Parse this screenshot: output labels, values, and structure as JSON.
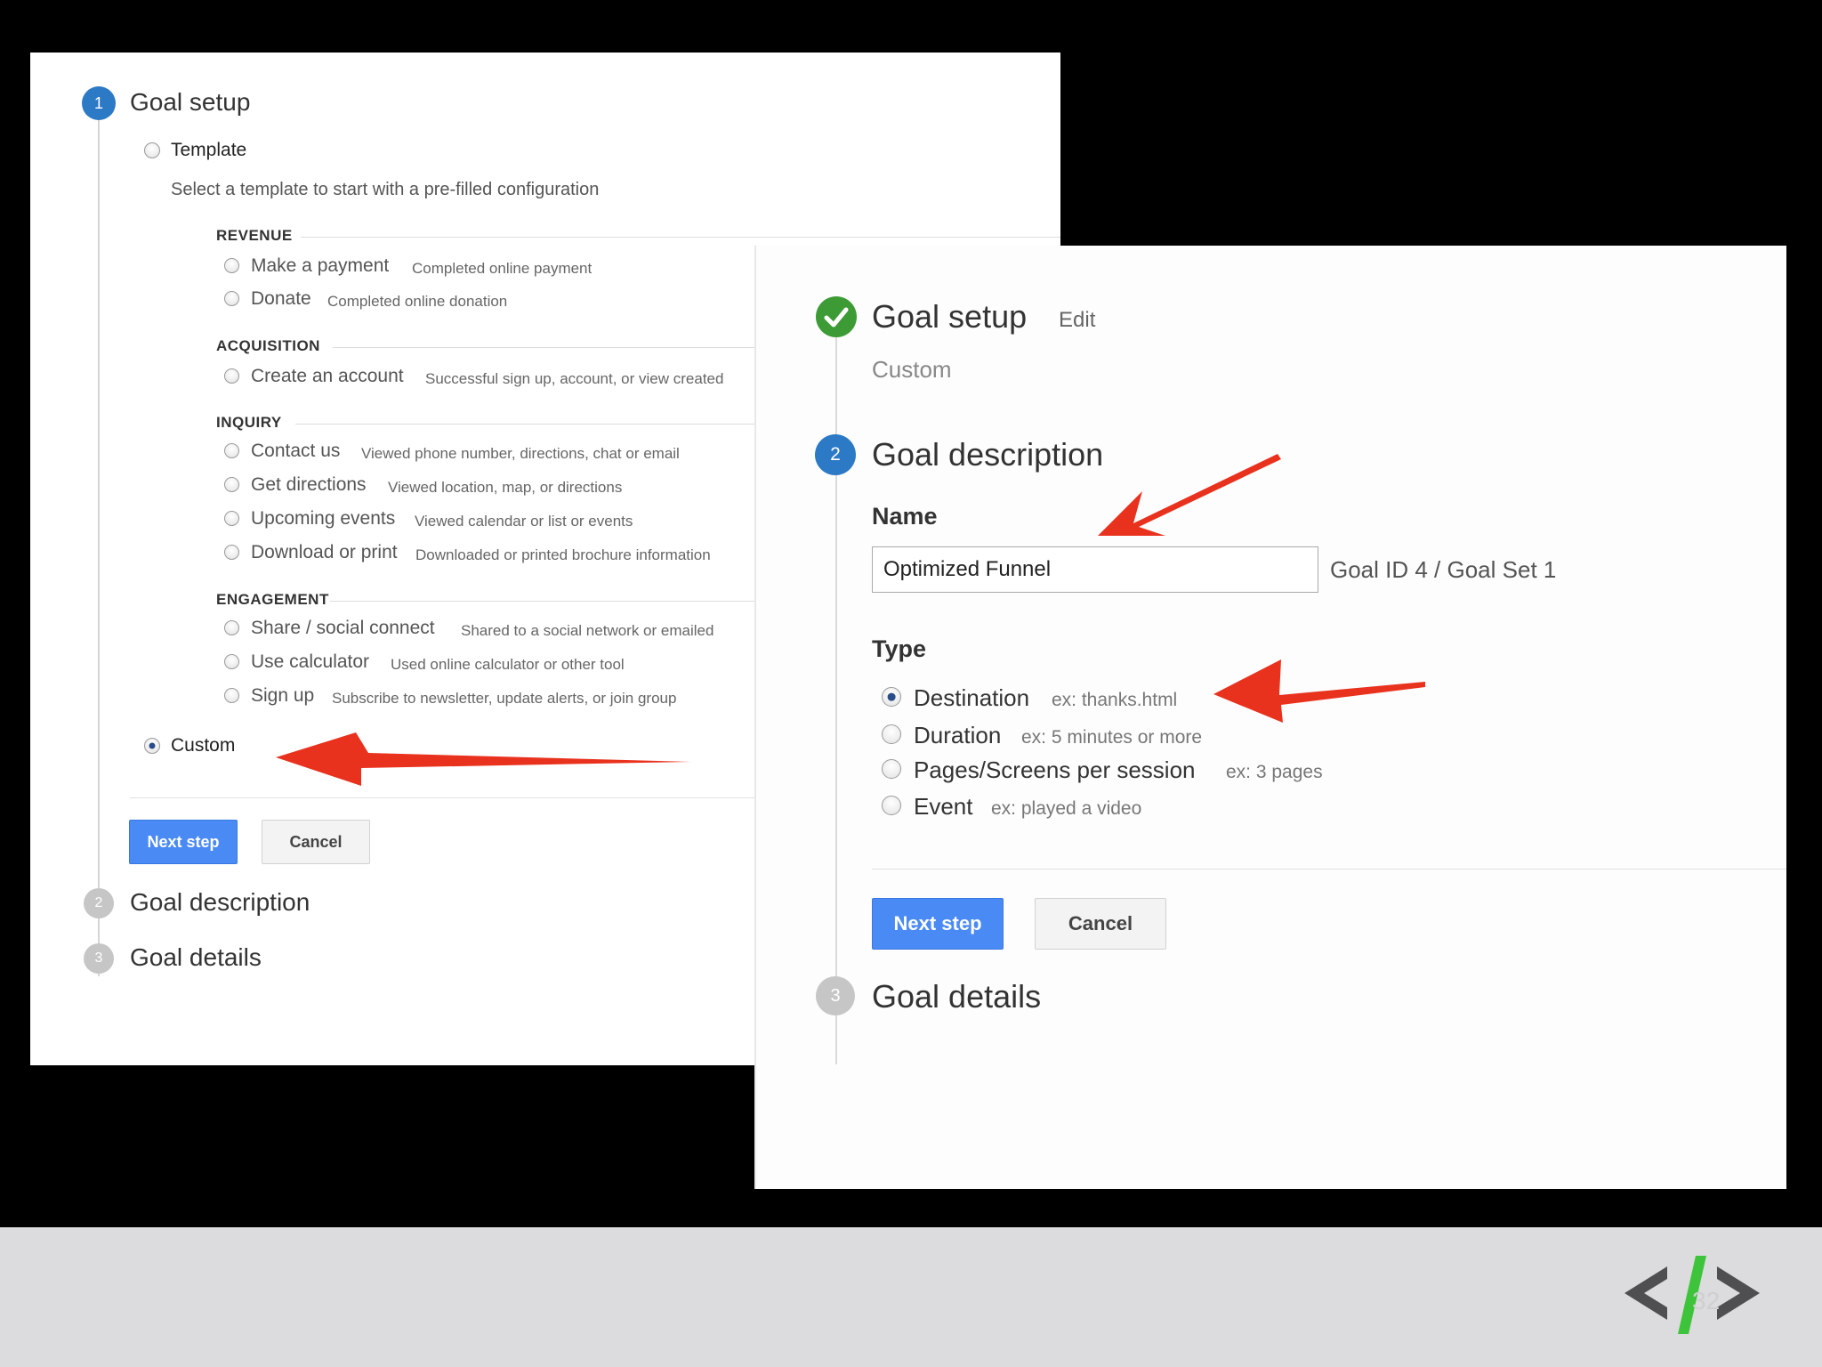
{
  "left_panel": {
    "step1": {
      "number": "1",
      "title": "Goal setup"
    },
    "template_label": "Template",
    "template_help": "Select a template to start with a pre-filled configuration",
    "categories": [
      {
        "label": "REVENUE",
        "items": [
          {
            "name": "Make a payment",
            "desc": "Completed online payment"
          },
          {
            "name": "Donate",
            "desc": "Completed online donation"
          }
        ]
      },
      {
        "label": "ACQUISITION",
        "items": [
          {
            "name": "Create an account",
            "desc": "Successful sign up, account, or view created"
          }
        ]
      },
      {
        "label": "INQUIRY",
        "items": [
          {
            "name": "Contact us",
            "desc": "Viewed phone number, directions, chat or email"
          },
          {
            "name": "Get directions",
            "desc": "Viewed location, map, or directions"
          },
          {
            "name": "Upcoming events",
            "desc": "Viewed calendar or list or events"
          },
          {
            "name": "Download or print",
            "desc": "Downloaded or printed brochure information"
          }
        ]
      },
      {
        "label": "ENGAGEMENT",
        "items": [
          {
            "name": "Share / social connect",
            "desc": "Shared to a social network or emailed"
          },
          {
            "name": "Use calculator",
            "desc": "Used online calculator or other tool"
          },
          {
            "name": "Sign up",
            "desc": "Subscribe to newsletter, update alerts, or join group"
          }
        ]
      }
    ],
    "custom_label": "Custom",
    "next_label": "Next step",
    "cancel_label": "Cancel",
    "step2": {
      "number": "2",
      "title": "Goal description"
    },
    "step3": {
      "number": "3",
      "title": "Goal details"
    }
  },
  "right_panel": {
    "step1": {
      "title": "Goal setup",
      "edit": "Edit",
      "value": "Custom"
    },
    "step2": {
      "number": "2",
      "title": "Goal description"
    },
    "name_label": "Name",
    "name_value": "Optimized Funnel",
    "goal_id": "Goal ID 4 / Goal Set 1",
    "type_label": "Type",
    "types": [
      {
        "name": "Destination",
        "example": "ex: thanks.html",
        "selected": true
      },
      {
        "name": "Duration",
        "example": "ex: 5 minutes or more",
        "selected": false
      },
      {
        "name": "Pages/Screens per session",
        "example": "ex: 3 pages",
        "selected": false
      },
      {
        "name": "Event",
        "example": "ex: played a video",
        "selected": false
      }
    ],
    "next_label": "Next step",
    "cancel_label": "Cancel",
    "step3": {
      "number": "3",
      "title": "Goal details"
    }
  },
  "footer": {
    "slide_number": "32"
  },
  "colors": {
    "step_blue": "#2c79c6",
    "success_green": "#3d9b35",
    "button_blue": "#4a8af4",
    "arrow_red": "#e8321e",
    "logo_green": "#3ec43a",
    "logo_grey": "#4f4f52"
  }
}
